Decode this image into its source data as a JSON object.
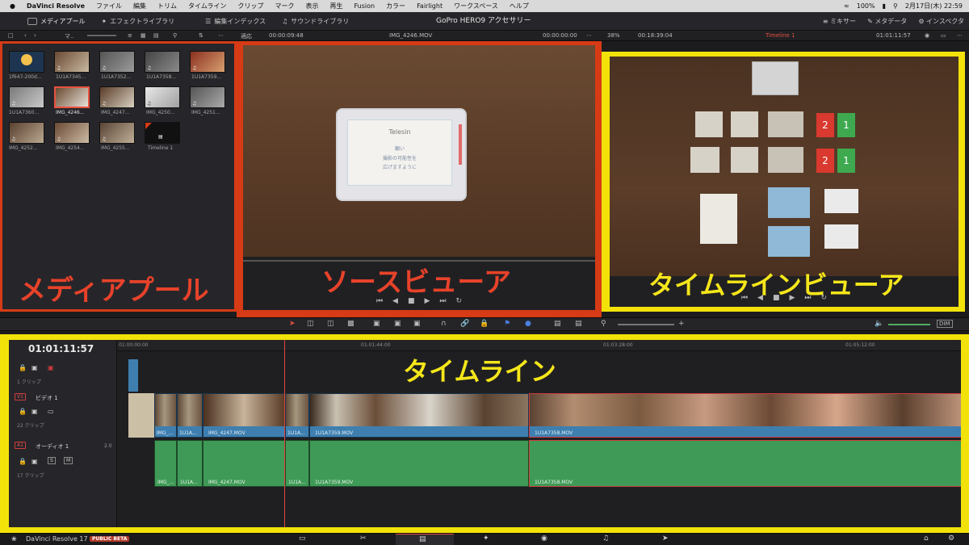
{
  "menubar": {
    "app_name": "DaVinci Resolve",
    "items": [
      "ファイル",
      "編集",
      "トリム",
      "タイムライン",
      "クリップ",
      "マーク",
      "表示",
      "再生",
      "Fusion",
      "カラー",
      "Fairlight",
      "ワークスペース",
      "ヘルプ"
    ],
    "battery": "100%",
    "datetime": "2月17日(木)  22:59"
  },
  "pagebar": {
    "tab_media_pool": "メディアプール",
    "tab_effects": "エフェクトライブラリ",
    "tab_edit_index": "編集インデックス",
    "tab_sound": "サウンドライブラリ",
    "project_title": "GoPro HERO9 アクセサリー",
    "mixer": "ミキサー",
    "metadata": "メタデータ",
    "inspector": "インスペクタ"
  },
  "toolbar": {
    "bin_label": "マ..",
    "fit": "適応",
    "source_tc": "00:00:09:48",
    "source_clip": "IMG_4246.MOV",
    "source_tc2": "00:00:00:00",
    "zoom": "38%",
    "duration": "00:18:39:04",
    "timeline_name": "Timeline 1",
    "timeline_tc": "01:01:11:57"
  },
  "media_pool": {
    "overlay_label": "メディアプール",
    "clips": [
      {
        "name": "1f647-200d..."
      },
      {
        "name": "1U1A7345..."
      },
      {
        "name": "1U1A7352..."
      },
      {
        "name": "1U1A7358..."
      },
      {
        "name": "1U1A7359..."
      },
      {
        "name": "1U1A7360..."
      },
      {
        "name": "IMG_4246..."
      },
      {
        "name": "IMG_4247..."
      },
      {
        "name": "IMG_4250..."
      },
      {
        "name": "IMG_4251..."
      },
      {
        "name": "IMG_4252..."
      },
      {
        "name": "IMG_4254..."
      },
      {
        "name": "IMG_4255..."
      },
      {
        "name": "Timeline 1"
      }
    ]
  },
  "source_viewer": {
    "overlay_label": "ソースビューア",
    "card_text1": "Telesin",
    "card_text2": "願い",
    "card_text3": "撮影の可能性を",
    "card_text4": "広げますように"
  },
  "timeline_viewer": {
    "overlay_label": "タイムラインビューア",
    "item_labels": [
      "2",
      "1",
      "2",
      "1"
    ]
  },
  "timeline": {
    "overlay_label": "タイムライン",
    "timecode": "01:01:11:57",
    "ruler": [
      "01:00:00:00",
      "01:01:44:00",
      "01:03:28:00",
      "01:05:12:00"
    ],
    "track_top_sub": "1 クリップ",
    "video_track_badge": "V1",
    "video_track_name": "ビデオ 1",
    "video_track_sub": "22 クリップ",
    "audio_track_badge": "A1",
    "audio_track_name": "オーディオ 1",
    "audio_level": "2.0",
    "audio_track_sub": "17 クリップ",
    "audio_s": "S",
    "audio_m": "M",
    "video_clips": [
      "IMG_...",
      "1U1A...",
      "IMG_4247.MOV",
      "1U1A...",
      "1U1A7359.MOV",
      "1U1A7358.MOV"
    ],
    "audio_clips": [
      "IMG_...",
      "1U1A...",
      "IMG_4247.MOV",
      "1U1A...",
      "1U1A7359.MOV",
      "1U1A7358.MOV"
    ]
  },
  "bottombar": {
    "app_version": "DaVinci Resolve 17",
    "beta_badge": "PUBLIC BETA"
  },
  "colors": {
    "media_pool_highlight": "#d63b16",
    "viewer_highlight": "#f2e20a",
    "label_red": "#e8422a",
    "label_yellow": "#f5e61a"
  }
}
